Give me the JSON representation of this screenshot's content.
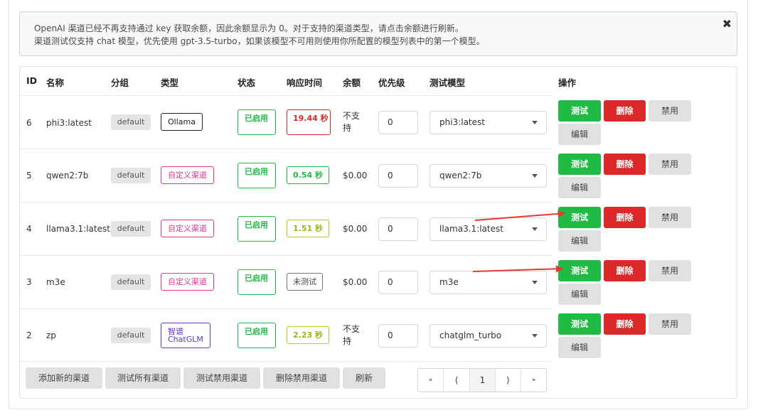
{
  "notice": {
    "line1": "OpenAI 渠道已经不再支持通过 key 获取余额，因此余额显示为 0。对于支持的渠道类型，请点击余额进行刷新。",
    "line2": "渠道测试仅支持 chat 模型，优先使用 gpt-3.5-turbo，如果该模型不可用则使用你所配置的模型列表中的第一个模型。",
    "close_glyph": "✖"
  },
  "table": {
    "headers": {
      "id": "ID",
      "name": "名称",
      "group": "分组",
      "type": "类型",
      "status": "状态",
      "response_time": "响应时间",
      "balance": "余额",
      "priority": "优先级",
      "test_model": "测试模型",
      "actions": "操作"
    },
    "rows": [
      {
        "id": "6",
        "name": "phi3:latest",
        "group": "default",
        "type": "Ollama",
        "status": "已启用",
        "response_time": "19.44 秒",
        "balance": "不支持",
        "priority": "0",
        "test_model": "phi3:latest"
      },
      {
        "id": "5",
        "name": "qwen2:7b",
        "group": "default",
        "type": "自定义渠道",
        "status": "已启用",
        "response_time": "0.54 秒",
        "balance": "$0.00",
        "priority": "0",
        "test_model": "qwen2:7b"
      },
      {
        "id": "4",
        "name": "llama3.1:latest",
        "group": "default",
        "type": "自定义渠道",
        "status": "已启用",
        "response_time": "1.51 秒",
        "balance": "$0.00",
        "priority": "0",
        "test_model": "llama3.1:latest"
      },
      {
        "id": "3",
        "name": "m3e",
        "group": "default",
        "type": "自定义渠道",
        "status": "已启用",
        "response_time": "未测试",
        "balance": "$0.00",
        "priority": "0",
        "test_model": "m3e"
      },
      {
        "id": "2",
        "name": "zp",
        "group": "default",
        "type_line1": "智谱",
        "type_line2": "ChatGLM",
        "status": "已启用",
        "response_time": "2.23 秒",
        "balance": "不支持",
        "priority": "0",
        "test_model": "chatglm_turbo"
      }
    ],
    "actions": {
      "test": "测试",
      "delete": "删除",
      "disable": "禁用",
      "edit": "编辑"
    }
  },
  "footer": {
    "add_channel": "添加新的渠道",
    "test_all": "测试所有渠道",
    "test_disabled": "测试禁用渠道",
    "delete_disabled": "删除禁用渠道",
    "refresh": "刷新"
  },
  "pagination": {
    "first": "«",
    "prev": "⟨",
    "current": "1",
    "next": "⟩",
    "last": "»"
  },
  "colors": {
    "green": "#21ba45",
    "red": "#db2828",
    "pink": "#e03997",
    "violet": "#6435c9",
    "olive": "#b5cc18",
    "arrow": "#e53935"
  }
}
